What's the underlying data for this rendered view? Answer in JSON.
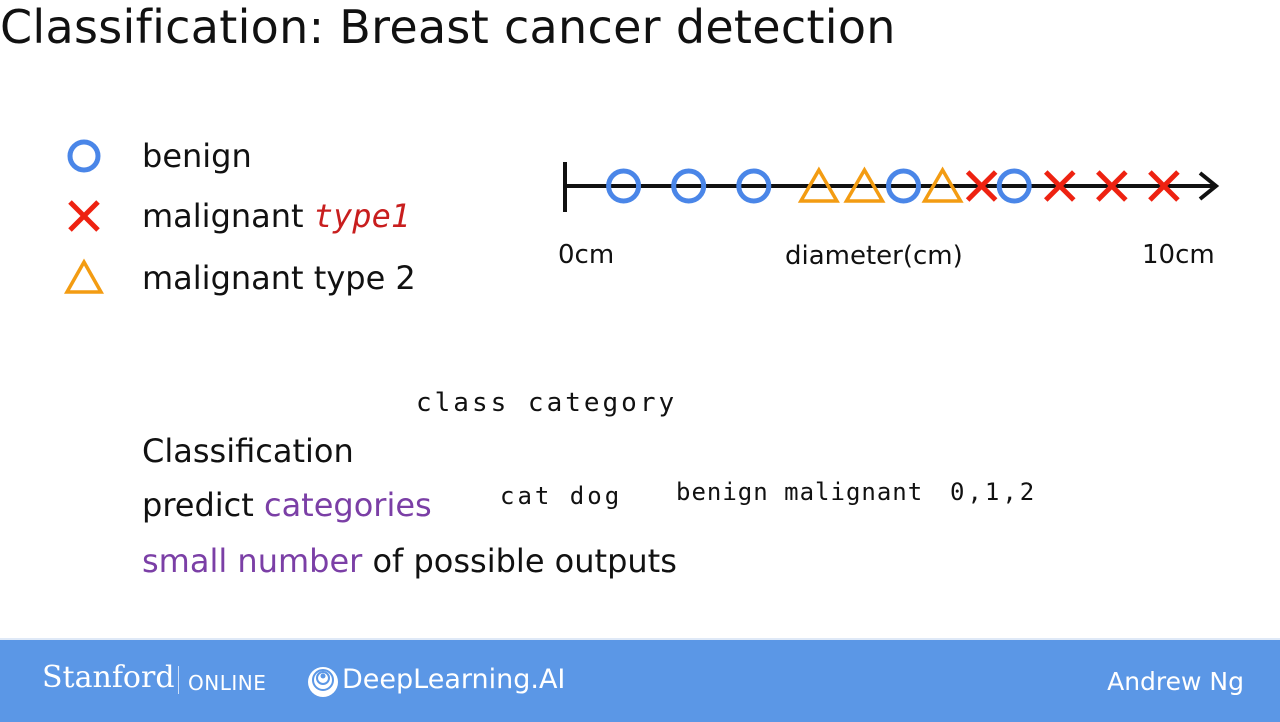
{
  "slide": {
    "title": "Classification: Breast cancer detection",
    "legend": [
      {
        "icon": "circle-icon",
        "label": "benign",
        "color": "#4a86e8"
      },
      {
        "icon": "cross-icon",
        "label": "malignant",
        "annotation": "type1",
        "color": "#ee2211"
      },
      {
        "icon": "triangle-icon",
        "label": "malignant type 2",
        "color": "#f39c12"
      }
    ],
    "body": {
      "classification": "Classification",
      "predict": "predict",
      "categories": "categories",
      "small_number": "small number",
      "outputs_rest": "of possible outputs"
    },
    "handwritten": {
      "class_category": "class  category",
      "examples": "cat dog",
      "examples2": "benign malignant",
      "numbers": "0,1,2"
    },
    "colors": {
      "purple": "#7b3fa6",
      "footer": "#5b97e6",
      "annotation_red": "#c81e1e"
    }
  },
  "footer": {
    "stanford": "Stanford",
    "online": "ONLINE",
    "deeplearning": "DeepLearning.AI",
    "author": "Andrew Ng"
  },
  "chart_data": {
    "type": "scatter",
    "title": "",
    "xlabel": "diameter(cm)",
    "x_start_label": "0cm",
    "x_end_label": "10cm",
    "xlim": [
      0,
      10
    ],
    "series": [
      {
        "name": "benign",
        "marker": "circle",
        "color": "#4a86e8",
        "x": [
          0.9,
          1.9,
          2.9,
          5.2,
          6.9
        ]
      },
      {
        "name": "malignant type 2",
        "marker": "triangle",
        "color": "#f39c12",
        "x": [
          3.9,
          4.6,
          5.8
        ]
      },
      {
        "name": "malignant type 1",
        "marker": "cross",
        "color": "#ee2211",
        "x": [
          6.4,
          7.6,
          8.4,
          9.2
        ]
      }
    ]
  }
}
